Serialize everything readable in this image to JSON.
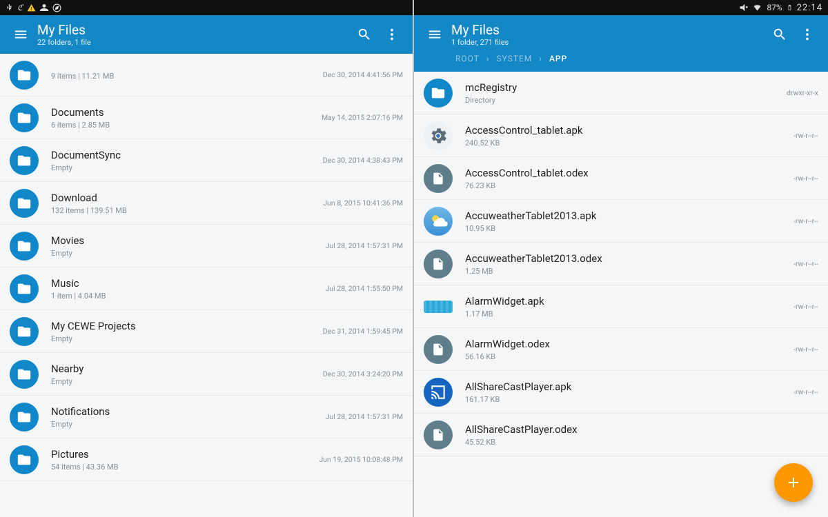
{
  "left": {
    "statusbar": {
      "icons": [
        "usb",
        "nyt",
        "warning",
        "person",
        "compass"
      ]
    },
    "title": "My Files",
    "subtitle": "22 folders, 1 file",
    "items": [
      {
        "icon": "folder",
        "name": "",
        "meta": "9 items  |  11.21 MB",
        "stamp": "Dec 30, 2014 4:41:56 PM"
      },
      {
        "icon": "folder",
        "name": "Documents",
        "meta": "6 items  |  2.85 MB",
        "stamp": "May 14, 2015 2:07:16 PM"
      },
      {
        "icon": "folder",
        "name": "DocumentSync",
        "meta": "Empty",
        "stamp": "Dec 30, 2014 4:38:43 PM"
      },
      {
        "icon": "folder",
        "name": "Download",
        "meta": "132 items  |  139.51 MB",
        "stamp": "Jun 8, 2015 10:41:36 PM"
      },
      {
        "icon": "folder",
        "name": "Movies",
        "meta": "Empty",
        "stamp": "Jul 28, 2014 1:57:31 PM"
      },
      {
        "icon": "folder",
        "name": "Music",
        "meta": "1 item  |  4.04 MB",
        "stamp": "Jul 28, 2014 1:55:50 PM"
      },
      {
        "icon": "folder",
        "name": "My CEWE Projects",
        "meta": "Empty",
        "stamp": "Dec 31, 2014 1:59:45 PM"
      },
      {
        "icon": "folder",
        "name": "Nearby",
        "meta": "Empty",
        "stamp": "Dec 30, 2014 3:24:20 PM"
      },
      {
        "icon": "folder",
        "name": "Notifications",
        "meta": "Empty",
        "stamp": "Jul 28, 2014 1:57:31 PM"
      },
      {
        "icon": "folder",
        "name": "Pictures",
        "meta": "54 items  |  43.36 MB",
        "stamp": "Jun 19, 2015 10:08:48 PM"
      }
    ]
  },
  "right": {
    "statusbar": {
      "battery": "87%",
      "clock": "22:14"
    },
    "title": "My Files",
    "subtitle": "1 folder, 271 files",
    "breadcrumbs": [
      "ROOT",
      "SYSTEM",
      "APP"
    ],
    "items": [
      {
        "icon": "folder",
        "name": "mcRegistry",
        "meta": "Directory",
        "stamp": "drwxr-xr-x"
      },
      {
        "icon": "gear",
        "name": "AccessControl_tablet.apk",
        "meta": "240.52 KB",
        "stamp": "-rw-r--r--"
      },
      {
        "icon": "file",
        "name": "AccessControl_tablet.odex",
        "meta": "76.23 KB",
        "stamp": "-rw-r--r--"
      },
      {
        "icon": "weather",
        "name": "AccuweatherTablet2013.apk",
        "meta": "10.95 KB",
        "stamp": "-rw-r--r--"
      },
      {
        "icon": "file",
        "name": "AccuweatherTablet2013.odex",
        "meta": "1.25 MB",
        "stamp": "-rw-r--r--"
      },
      {
        "icon": "alarm",
        "name": "AlarmWidget.apk",
        "meta": "1.17 MB",
        "stamp": "-rw-r--r--"
      },
      {
        "icon": "file",
        "name": "AlarmWidget.odex",
        "meta": "56.16 KB",
        "stamp": "-rw-r--r--"
      },
      {
        "icon": "cast",
        "name": "AllShareCastPlayer.apk",
        "meta": "161.17 KB",
        "stamp": "-rw-r--r--"
      },
      {
        "icon": "file",
        "name": "AllShareCastPlayer.odex",
        "meta": "45.52 KB",
        "stamp": ""
      }
    ]
  }
}
